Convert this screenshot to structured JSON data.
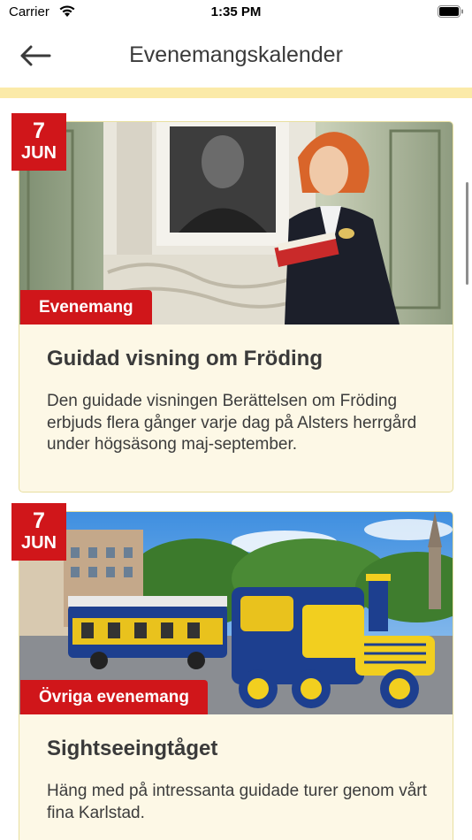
{
  "status_bar": {
    "carrier": "Carrier",
    "time": "1:35 PM"
  },
  "nav": {
    "title": "Evenemangskalender",
    "back_icon": "arrow-left-icon"
  },
  "events": [
    {
      "day": "7",
      "month": "JUN",
      "category": "Evenemang",
      "title": "Guidad visning om Fröding",
      "description": "Den guidade visningen Berättelsen om Fröding erbjuds flera gånger varje dag på Alsters herrgård under högsäsong maj-september."
    },
    {
      "day": "7",
      "month": "JUN",
      "category": "Övriga evenemang",
      "title": "Sightseeingtåget",
      "description": "Häng med på intressanta guidade turer genom vårt fina Karlstad."
    }
  ],
  "colors": {
    "accent_red": "#d0161a",
    "card_background": "#fdf8e6",
    "strip_yellow": "#fbeaa8"
  }
}
